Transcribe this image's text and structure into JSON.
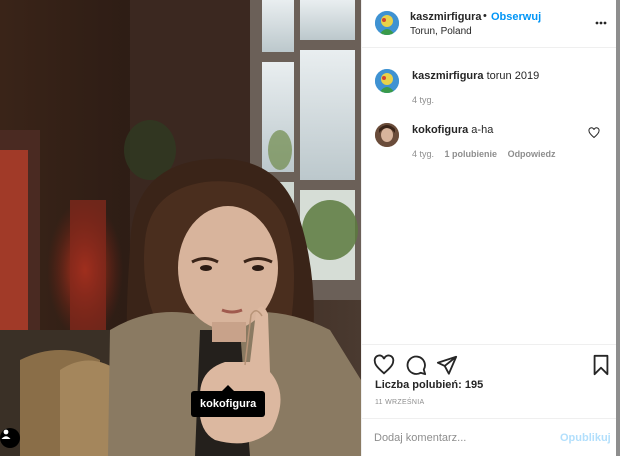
{
  "post": {
    "author": "kaszmirfigura",
    "follow_separator": "•",
    "follow_label": "Obserwuj",
    "location": "Torun, Poland",
    "photo_tag": "kokofigura"
  },
  "caption": {
    "username": "kaszmirfigura",
    "text": "torun 2019",
    "time": "4 tyg."
  },
  "comments": [
    {
      "username": "kokofigura",
      "text": "a-ha",
      "time": "4 tyg.",
      "likes": "1 polubienie",
      "reply_label": "Odpowiedz"
    }
  ],
  "footer": {
    "likes_label": "Liczba polubień: 195",
    "date": "11 WRZEŚNIA",
    "comment_placeholder": "Dodaj komentarz...",
    "post_button": "Opublikuj"
  },
  "colors": {
    "accent": "#0095f6",
    "post_button_disabled": "#b2dffc",
    "muted_text": "#8e8e8e"
  },
  "icons": {
    "more": "more-options-icon",
    "like": "heart-icon",
    "comment": "comment-bubble-icon",
    "share": "paper-plane-icon",
    "save": "bookmark-icon",
    "user_tags": "user-tag-icon"
  }
}
